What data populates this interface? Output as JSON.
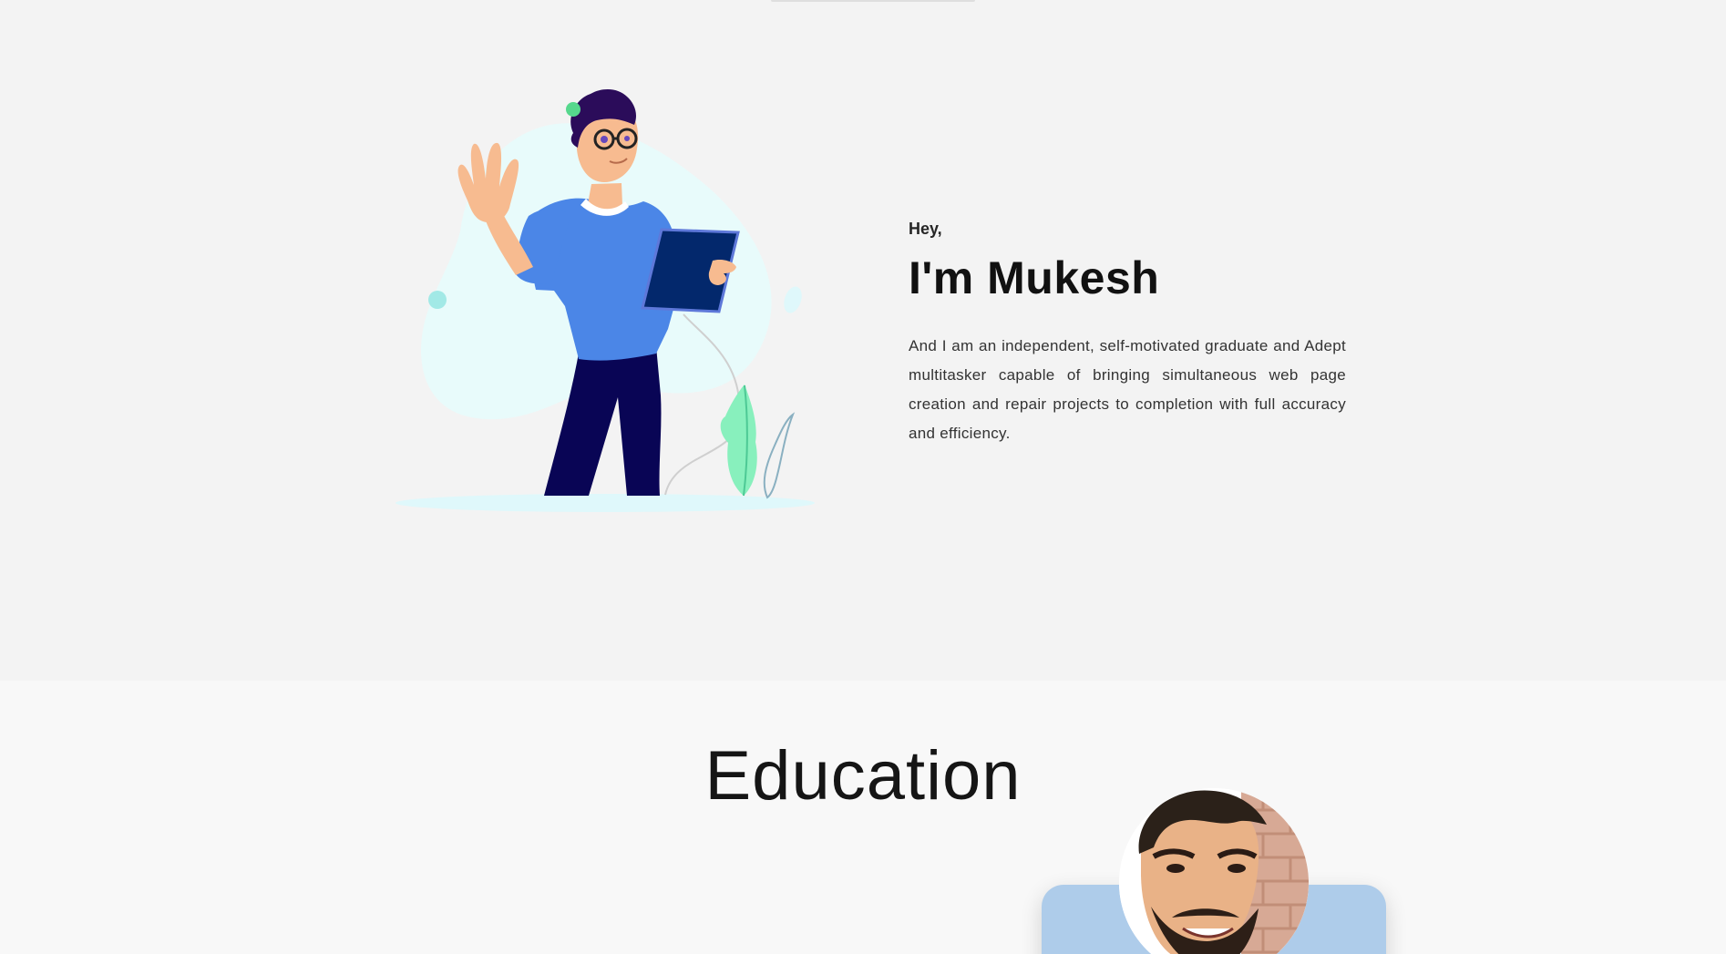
{
  "hero": {
    "greeting": "Hey,",
    "title": "I'm Mukesh",
    "description": "And I am an independent, self-motivated graduate and Adept multitasker capable of bringing simultaneous web page creation and repair projects to completion with full accuracy and efficiency."
  },
  "education": {
    "title": "Education"
  },
  "colors": {
    "hero_bg": "#f3f3f3",
    "education_bg": "#f8f8f8",
    "card_bg": "#aeccea",
    "shirt": "#4b86e7",
    "pants": "#090555",
    "tablet": "#03286c",
    "blob": "#e8fbfb",
    "plant": "#88f0bd"
  },
  "icons": {
    "hero_illustration": "waving-person-illustration",
    "profile_photo": "profile-avatar"
  }
}
